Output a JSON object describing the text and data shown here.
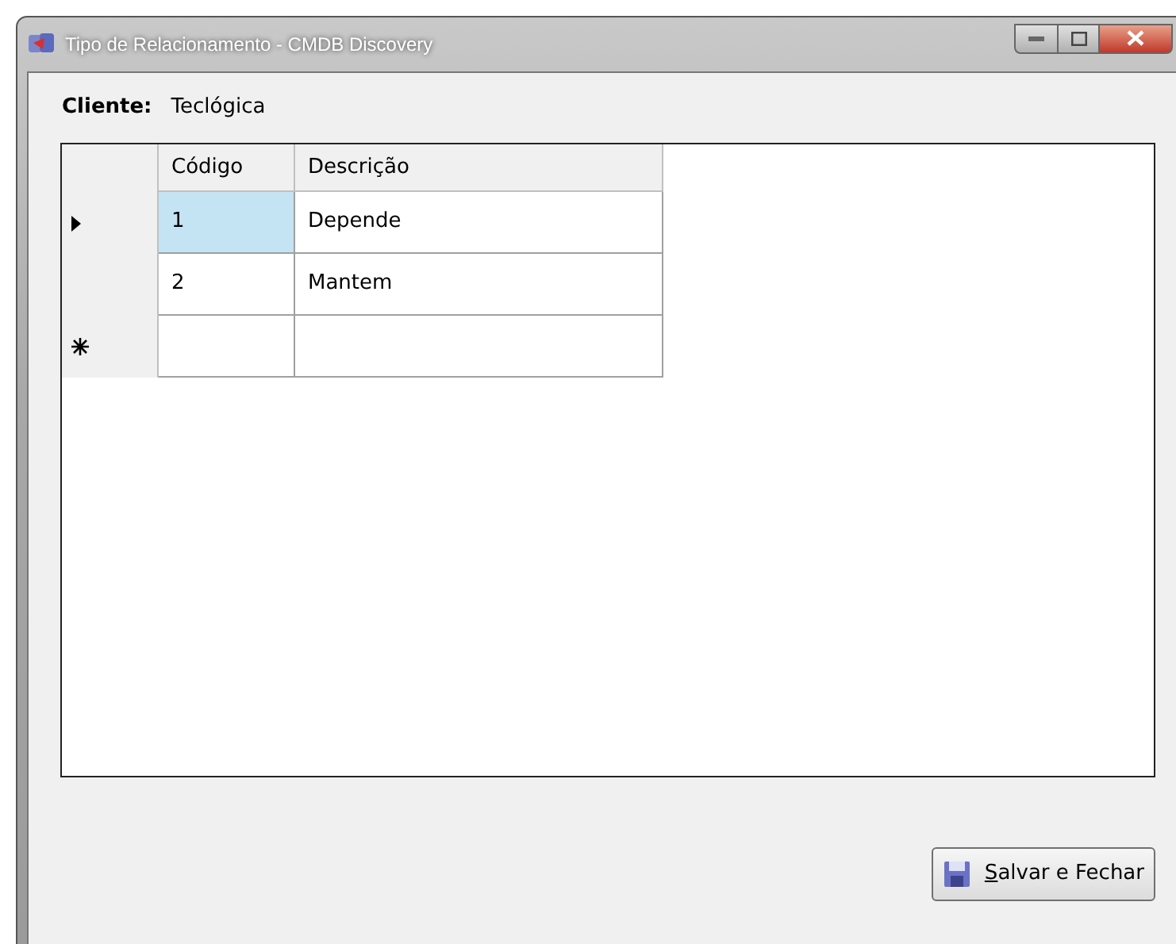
{
  "window": {
    "title": "Tipo de Relacionamento - CMDB Discovery"
  },
  "client": {
    "label": "Cliente:",
    "value": "Teclógica"
  },
  "table": {
    "columns": [
      "Código",
      "Descrição"
    ],
    "rows": [
      {
        "kind": "current",
        "cells": [
          {
            "text": "1",
            "selected": true
          },
          {
            "text": "Depende",
            "selected": false
          }
        ]
      },
      {
        "kind": "plain",
        "cells": [
          {
            "text": "2",
            "selected": false
          },
          {
            "text": "Mantem",
            "selected": false
          }
        ]
      },
      {
        "kind": "new",
        "cells": [
          {
            "text": "",
            "selected": false
          },
          {
            "text": "",
            "selected": false
          }
        ]
      }
    ]
  },
  "save_button": {
    "access_key": "S",
    "label_rest": "alvar e Fechar"
  }
}
